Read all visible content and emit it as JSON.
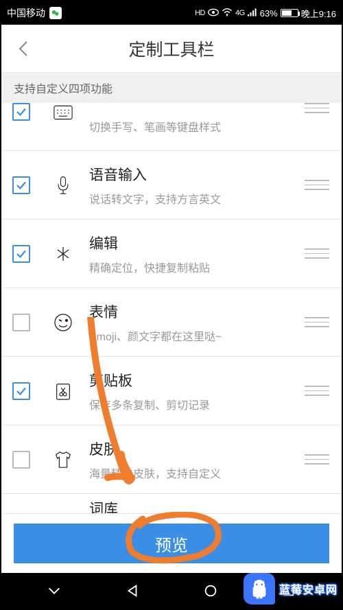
{
  "status": {
    "carrier": "中国移动",
    "hd": "HD",
    "signal_4g": "4G",
    "battery_pct": "63%",
    "time": "晚上9:16"
  },
  "header": {
    "title": "定制工具栏"
  },
  "subtitle": "支持自定义四项功能",
  "items": [
    {
      "title": "",
      "desc": "切换手写、笔画等键盘样式",
      "checked": true,
      "icon": "keyboard-icon"
    },
    {
      "title": "语音输入",
      "desc": "说话转文字，支持方言英文",
      "checked": true,
      "icon": "microphone-icon"
    },
    {
      "title": "编辑",
      "desc": "精确定位，快捷复制粘贴",
      "checked": true,
      "icon": "cursor-icon"
    },
    {
      "title": "表情",
      "desc": "Emoji、颜文字都在这里哒~",
      "checked": false,
      "icon": "emoji-icon"
    },
    {
      "title": "剪贴板",
      "desc": "保存多条复制、剪切记录",
      "checked": true,
      "icon": "clipboard-scissors-icon"
    },
    {
      "title": "皮肤",
      "desc": "海量精美皮肤，支持自定义",
      "checked": false,
      "icon": "tshirt-icon"
    },
    {
      "title": "词库",
      "desc": "",
      "checked": false,
      "icon": "dictionary-icon"
    }
  ],
  "preview": {
    "label": "预览"
  },
  "watermark": {
    "text": "蓝莓安卓网"
  },
  "colors": {
    "accent": "#3a8ee6",
    "annotation": "#f07d2e"
  }
}
